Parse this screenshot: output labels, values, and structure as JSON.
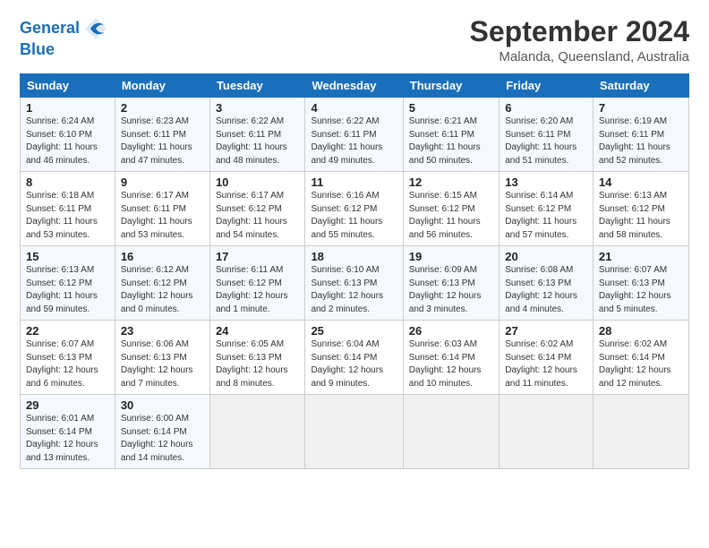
{
  "header": {
    "logo_text_general": "General",
    "logo_text_blue": "Blue",
    "month_title": "September 2024",
    "location": "Malanda, Queensland, Australia"
  },
  "calendar": {
    "days_of_week": [
      "Sunday",
      "Monday",
      "Tuesday",
      "Wednesday",
      "Thursday",
      "Friday",
      "Saturday"
    ],
    "weeks": [
      [
        {
          "day": "1",
          "sunrise": "6:24 AM",
          "sunset": "6:10 PM",
          "daylight": "11 hours and 46 minutes."
        },
        {
          "day": "2",
          "sunrise": "6:23 AM",
          "sunset": "6:11 PM",
          "daylight": "11 hours and 47 minutes."
        },
        {
          "day": "3",
          "sunrise": "6:22 AM",
          "sunset": "6:11 PM",
          "daylight": "11 hours and 48 minutes."
        },
        {
          "day": "4",
          "sunrise": "6:22 AM",
          "sunset": "6:11 PM",
          "daylight": "11 hours and 49 minutes."
        },
        {
          "day": "5",
          "sunrise": "6:21 AM",
          "sunset": "6:11 PM",
          "daylight": "11 hours and 50 minutes."
        },
        {
          "day": "6",
          "sunrise": "6:20 AM",
          "sunset": "6:11 PM",
          "daylight": "11 hours and 51 minutes."
        },
        {
          "day": "7",
          "sunrise": "6:19 AM",
          "sunset": "6:11 PM",
          "daylight": "11 hours and 52 minutes."
        }
      ],
      [
        {
          "day": "8",
          "sunrise": "6:18 AM",
          "sunset": "6:11 PM",
          "daylight": "11 hours and 53 minutes."
        },
        {
          "day": "9",
          "sunrise": "6:17 AM",
          "sunset": "6:11 PM",
          "daylight": "11 hours and 53 minutes."
        },
        {
          "day": "10",
          "sunrise": "6:17 AM",
          "sunset": "6:12 PM",
          "daylight": "11 hours and 54 minutes."
        },
        {
          "day": "11",
          "sunrise": "6:16 AM",
          "sunset": "6:12 PM",
          "daylight": "11 hours and 55 minutes."
        },
        {
          "day": "12",
          "sunrise": "6:15 AM",
          "sunset": "6:12 PM",
          "daylight": "11 hours and 56 minutes."
        },
        {
          "day": "13",
          "sunrise": "6:14 AM",
          "sunset": "6:12 PM",
          "daylight": "11 hours and 57 minutes."
        },
        {
          "day": "14",
          "sunrise": "6:13 AM",
          "sunset": "6:12 PM",
          "daylight": "11 hours and 58 minutes."
        }
      ],
      [
        {
          "day": "15",
          "sunrise": "6:13 AM",
          "sunset": "6:12 PM",
          "daylight": "11 hours and 59 minutes."
        },
        {
          "day": "16",
          "sunrise": "6:12 AM",
          "sunset": "6:12 PM",
          "daylight": "12 hours and 0 minutes."
        },
        {
          "day": "17",
          "sunrise": "6:11 AM",
          "sunset": "6:12 PM",
          "daylight": "12 hours and 1 minute."
        },
        {
          "day": "18",
          "sunrise": "6:10 AM",
          "sunset": "6:13 PM",
          "daylight": "12 hours and 2 minutes."
        },
        {
          "day": "19",
          "sunrise": "6:09 AM",
          "sunset": "6:13 PM",
          "daylight": "12 hours and 3 minutes."
        },
        {
          "day": "20",
          "sunrise": "6:08 AM",
          "sunset": "6:13 PM",
          "daylight": "12 hours and 4 minutes."
        },
        {
          "day": "21",
          "sunrise": "6:07 AM",
          "sunset": "6:13 PM",
          "daylight": "12 hours and 5 minutes."
        }
      ],
      [
        {
          "day": "22",
          "sunrise": "6:07 AM",
          "sunset": "6:13 PM",
          "daylight": "12 hours and 6 minutes."
        },
        {
          "day": "23",
          "sunrise": "6:06 AM",
          "sunset": "6:13 PM",
          "daylight": "12 hours and 7 minutes."
        },
        {
          "day": "24",
          "sunrise": "6:05 AM",
          "sunset": "6:13 PM",
          "daylight": "12 hours and 8 minutes."
        },
        {
          "day": "25",
          "sunrise": "6:04 AM",
          "sunset": "6:14 PM",
          "daylight": "12 hours and 9 minutes."
        },
        {
          "day": "26",
          "sunrise": "6:03 AM",
          "sunset": "6:14 PM",
          "daylight": "12 hours and 10 minutes."
        },
        {
          "day": "27",
          "sunrise": "6:02 AM",
          "sunset": "6:14 PM",
          "daylight": "12 hours and 11 minutes."
        },
        {
          "day": "28",
          "sunrise": "6:02 AM",
          "sunset": "6:14 PM",
          "daylight": "12 hours and 12 minutes."
        }
      ],
      [
        {
          "day": "29",
          "sunrise": "6:01 AM",
          "sunset": "6:14 PM",
          "daylight": "12 hours and 13 minutes."
        },
        {
          "day": "30",
          "sunrise": "6:00 AM",
          "sunset": "6:14 PM",
          "daylight": "12 hours and 14 minutes."
        },
        null,
        null,
        null,
        null,
        null
      ]
    ]
  }
}
